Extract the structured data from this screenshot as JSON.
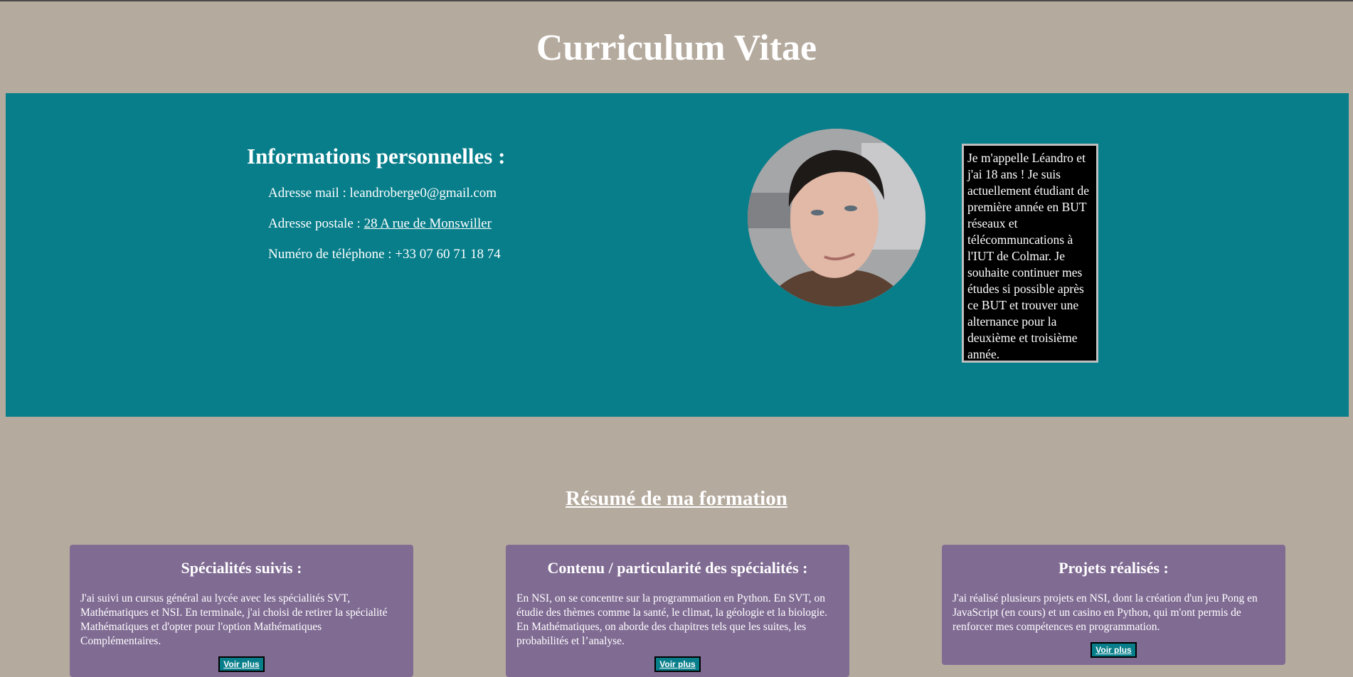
{
  "header": {
    "title": "Curriculum Vitae"
  },
  "personal": {
    "heading": "Informations personnelles :",
    "email_label": "Adresse mail : ",
    "email_value": "leandroberge0@gmail.com",
    "address_label": "Adresse postale : ",
    "address_link": "28 A rue de Monswiller",
    "phone_label": "Numéro de téléphone : ",
    "phone_value": "+33 07 60 71 18 74"
  },
  "bio": {
    "text": "Je m'appelle Léandro et j'ai 18 ans ! Je suis actuellement étudiant de première année en BUT réseaux et télécommuncations à l'IUT de Colmar. Je souhaite continuer mes études si possible après ce BUT et trouver une alternance pour la deuxième et troisième année."
  },
  "formation": {
    "heading": "Résumé de ma formation",
    "cards": [
      {
        "title": "Spécialités suivis :",
        "text": "J'ai suivi un cursus général au lycée avec les spécialités SVT, Mathématiques et NSI. En terminale, j'ai choisi de retirer la spécialité Mathématiques et d'opter pour l'option Mathématiques Complémentaires.",
        "button": "Voir plus"
      },
      {
        "title": "Contenu / particularité des spécialités :",
        "text": "En NSI, on se concentre sur la programmation en Python. En SVT, on étudie des thèmes comme la santé, le climat, la géologie et la biologie. En Mathématiques, on aborde des chapitres tels que les suites, les probabilités et l’analyse.",
        "button": "Voir plus"
      },
      {
        "title": "Projets réalisés :",
        "text": "J'ai réalisé plusieurs projets en NSI, dont la création d'un jeu Pong en JavaScript (en cours) et un casino en Python, qui m'ont permis de renforcer mes compétences en programmation.",
        "button": "Voir plus"
      }
    ]
  },
  "colors": {
    "page_background": "#b5aa9e",
    "band": "#077e8a",
    "card": "#806b93",
    "bio_box": "#000000"
  }
}
